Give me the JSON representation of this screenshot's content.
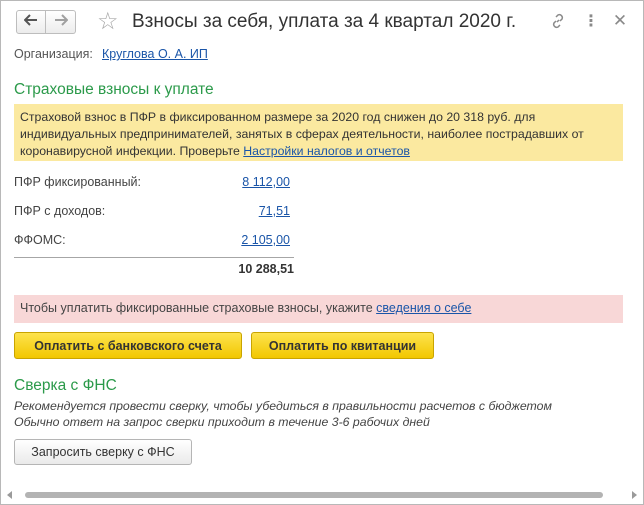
{
  "window": {
    "title": "Взносы за себя, уплата за 4 квартал 2020 г.",
    "icons": {
      "back": "arrow-left-icon",
      "forward": "arrow-right-icon",
      "favorite": "star-icon",
      "link": "link-icon",
      "more": "more-vertical-icon",
      "close": "close-icon"
    }
  },
  "organization": {
    "label": "Организация:",
    "value": "Круглова О. А. ИП"
  },
  "insurance": {
    "title": "Страховые взносы к уплате",
    "info": {
      "text_line1": "Страховой взнос в ПФР в фиксированном размере за 2020 год снижен до 20 318 руб. для",
      "text_line2": "индивидуальных предпринимателей, занятых в сферах деятельности, наиболее пострадавших от",
      "text_line3": "коронавирусной инфекции. Проверьте ",
      "link": "Настройки налогов и отчетов"
    },
    "rows": [
      {
        "label": "ПФР фиксированный:",
        "value": "8 112,00"
      },
      {
        "label": "ПФР с доходов:",
        "value": "71,51"
      },
      {
        "label": "ФФОМС:",
        "value": "2 105,00"
      }
    ],
    "total": "10 288,51"
  },
  "warning": {
    "text": "Чтобы уплатить фиксированные страховые взносы, укажите ",
    "link": "сведения о себе"
  },
  "buttons": {
    "pay_bank": "Оплатить с банковского счета",
    "pay_receipt": "Оплатить по квитанции",
    "request_fns": "Запросить сверку с ФНС"
  },
  "fns": {
    "title": "Сверка с ФНС",
    "hint1": "Рекомендуется провести сверку, чтобы убедиться в правильности расчетов с бюджетом",
    "hint2": "Обычно ответ на запрос сверки приходит в течение 3-6 рабочих дней"
  },
  "colors": {
    "section_title": "#2b9a4a",
    "link": "#1a55a8",
    "info_bg": "#fbe9a0",
    "warning_bg": "#f8d7d7",
    "primary_button": "#f5cd0c"
  }
}
